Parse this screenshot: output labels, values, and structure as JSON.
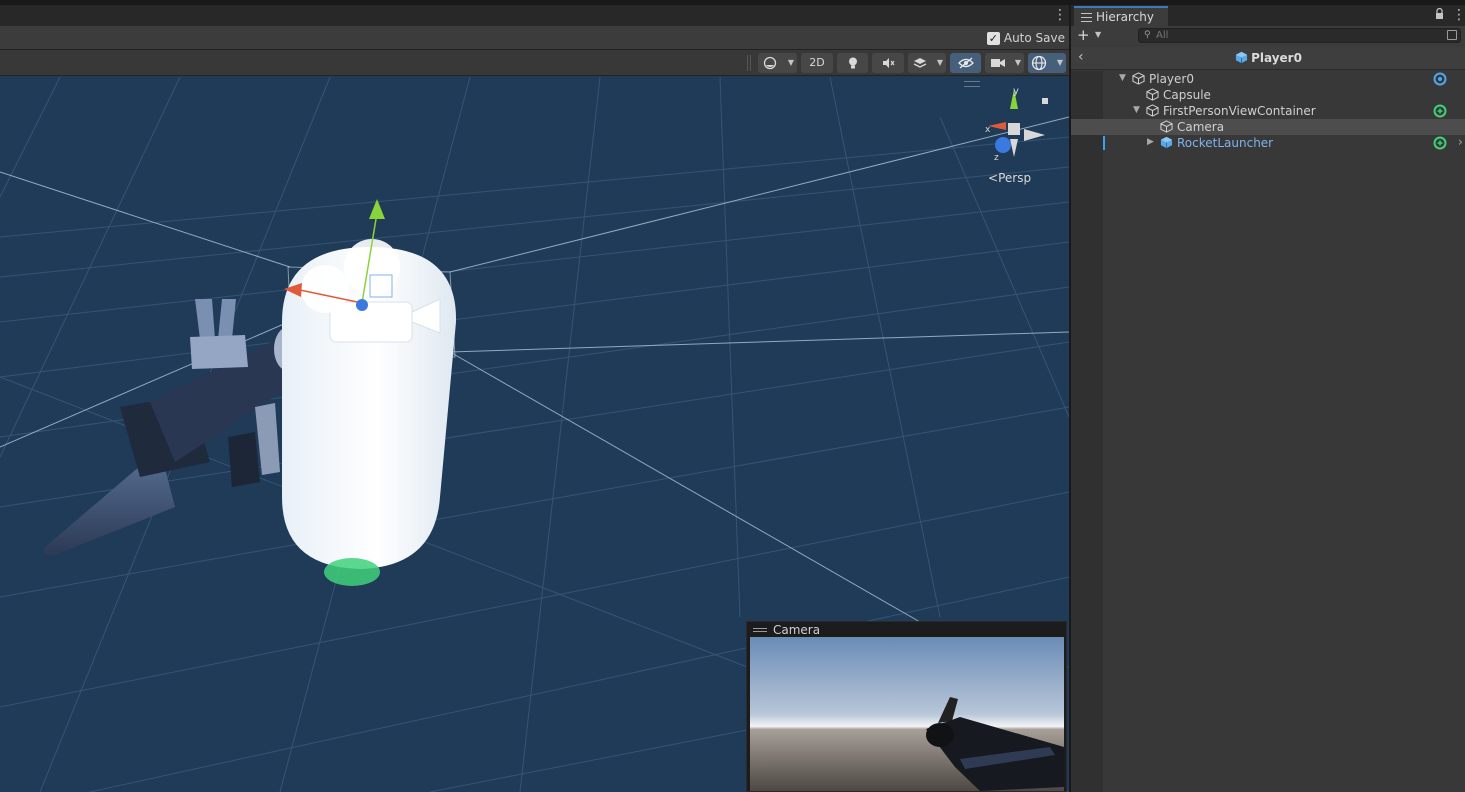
{
  "scene": {
    "autosave_label": "Auto Save",
    "autosave_checked": true,
    "toolbar": {
      "btn_2d": "2D"
    },
    "gizmo": {
      "axis_y": "y",
      "axis_x": "x",
      "axis_z": "z",
      "projection": "Persp"
    },
    "camera_preview": {
      "title": "Camera"
    }
  },
  "hierarchy": {
    "tab_title": "Hierarchy",
    "add_label": "+",
    "search_placeholder": "All",
    "breadcrumb": "Player0",
    "items": [
      {
        "label": "Player0",
        "depth": 0,
        "expanded": true,
        "icon": "gameobject-icon",
        "right_icon": "prefab-override-icon"
      },
      {
        "label": "Capsule",
        "depth": 1,
        "icon": "gameobject-icon"
      },
      {
        "label": "FirstPersonViewContainer",
        "depth": 1,
        "expanded": true,
        "icon": "gameobject-icon",
        "right_icon": "prefab-added-icon"
      },
      {
        "label": "Camera",
        "depth": 2,
        "icon": "gameobject-icon",
        "selected": true
      },
      {
        "label": "RocketLauncher",
        "depth": 2,
        "expanded": false,
        "icon": "prefab-icon",
        "prefab": true,
        "right_icon": "prefab-added-icon"
      }
    ]
  },
  "colors": {
    "scene_bg": "#1f3b58",
    "prefab_text": "#7fb3ec",
    "accent": "#3a79bb",
    "added_green": "#3fd17a"
  }
}
